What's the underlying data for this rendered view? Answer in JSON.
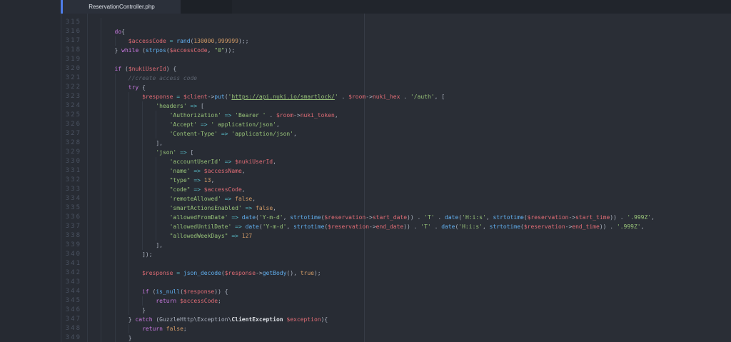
{
  "colors": {
    "bg": "#282c34",
    "sidebar_bg": "#262a32",
    "tabbar_bg": "#21252c",
    "tab_active_bg": "#2b303a",
    "accent": "#4e7de9",
    "text": "#abb2bf",
    "keyword": "#c678dd",
    "variable": "#e06c75",
    "function": "#61afef",
    "string": "#98c379",
    "number": "#d19a66",
    "operator": "#56b6c2",
    "comment": "#5b626e",
    "class": "#dcdfe4",
    "gutter": "#4a5261"
  },
  "tabbar": {
    "tabs": [
      {
        "label": "ReservationController.php",
        "active": true
      }
    ]
  },
  "editor": {
    "first_visible_line": 315,
    "last_visible_line": 349,
    "clipped_line_hint": "...",
    "lines": [
      {
        "n": 315,
        "indent": 2,
        "tokens": []
      },
      {
        "n": 316,
        "indent": 2,
        "tokens": [
          [
            "kw",
            "do"
          ],
          [
            "txt",
            "{"
          ]
        ]
      },
      {
        "n": 317,
        "indent": 3,
        "tokens": [
          [
            "var",
            "$accessCode"
          ],
          [
            "txt",
            " "
          ],
          [
            "op",
            "="
          ],
          [
            "txt",
            " "
          ],
          [
            "fn",
            "rand"
          ],
          [
            "txt",
            "("
          ],
          [
            "num",
            "130000"
          ],
          [
            "txt",
            ","
          ],
          [
            "num",
            "999999"
          ],
          [
            "txt",
            ");;"
          ]
        ]
      },
      {
        "n": 318,
        "indent": 2,
        "tokens": [
          [
            "txt",
            "} "
          ],
          [
            "kw",
            "while"
          ],
          [
            "txt",
            " ("
          ],
          [
            "fn",
            "strpos"
          ],
          [
            "txt",
            "("
          ],
          [
            "var",
            "$accessCode"
          ],
          [
            "txt",
            ", "
          ],
          [
            "str",
            "\"0\""
          ],
          [
            "txt",
            "));"
          ]
        ]
      },
      {
        "n": 319,
        "indent": 2,
        "tokens": []
      },
      {
        "n": 320,
        "indent": 2,
        "tokens": [
          [
            "kw",
            "if"
          ],
          [
            "txt",
            " ("
          ],
          [
            "var",
            "$nukiUserId"
          ],
          [
            "txt",
            ") {"
          ]
        ]
      },
      {
        "n": 321,
        "indent": 3,
        "tokens": [
          [
            "cmt",
            "//create access code"
          ]
        ]
      },
      {
        "n": 322,
        "indent": 3,
        "tokens": [
          [
            "kw",
            "try"
          ],
          [
            "txt",
            " {"
          ]
        ]
      },
      {
        "n": 323,
        "indent": 4,
        "tokens": [
          [
            "var",
            "$response"
          ],
          [
            "txt",
            " "
          ],
          [
            "op",
            "="
          ],
          [
            "txt",
            " "
          ],
          [
            "var",
            "$client"
          ],
          [
            "txt",
            "->"
          ],
          [
            "fn",
            "put"
          ],
          [
            "txt",
            "("
          ],
          [
            "str",
            "'"
          ],
          [
            "url",
            "https://api.nuki.io/smartlock/"
          ],
          [
            "str",
            "'"
          ],
          [
            "txt",
            " . "
          ],
          [
            "var",
            "$room"
          ],
          [
            "txt",
            "->"
          ],
          [
            "var",
            "nuki_hex"
          ],
          [
            "txt",
            " . "
          ],
          [
            "str",
            "'/auth'"
          ],
          [
            "txt",
            ", ["
          ]
        ]
      },
      {
        "n": 324,
        "indent": 5,
        "tokens": [
          [
            "str",
            "'headers'"
          ],
          [
            "txt",
            " "
          ],
          [
            "op",
            "=>"
          ],
          [
            "txt",
            " ["
          ]
        ]
      },
      {
        "n": 325,
        "indent": 6,
        "tokens": [
          [
            "str",
            "'Authorization'"
          ],
          [
            "txt",
            " "
          ],
          [
            "op",
            "=>"
          ],
          [
            "txt",
            " "
          ],
          [
            "str",
            "'Bearer '"
          ],
          [
            "txt",
            " . "
          ],
          [
            "var",
            "$room"
          ],
          [
            "txt",
            "->"
          ],
          [
            "var",
            "nuki_token"
          ],
          [
            "txt",
            ","
          ]
        ]
      },
      {
        "n": 326,
        "indent": 6,
        "tokens": [
          [
            "str",
            "'Accept'"
          ],
          [
            "txt",
            " "
          ],
          [
            "op",
            "=>"
          ],
          [
            "txt",
            " "
          ],
          [
            "str",
            "' application/json'"
          ],
          [
            "txt",
            ","
          ]
        ]
      },
      {
        "n": 327,
        "indent": 6,
        "tokens": [
          [
            "str",
            "'Content-Type'"
          ],
          [
            "txt",
            " "
          ],
          [
            "op",
            "=>"
          ],
          [
            "txt",
            " "
          ],
          [
            "str",
            "'application/json'"
          ],
          [
            "txt",
            ","
          ]
        ]
      },
      {
        "n": 328,
        "indent": 5,
        "tokens": [
          [
            "txt",
            "],"
          ]
        ]
      },
      {
        "n": 329,
        "indent": 5,
        "tokens": [
          [
            "str",
            "'json'"
          ],
          [
            "txt",
            " "
          ],
          [
            "op",
            "=>"
          ],
          [
            "txt",
            " ["
          ]
        ]
      },
      {
        "n": 330,
        "indent": 6,
        "tokens": [
          [
            "str",
            "'accountUserId'"
          ],
          [
            "txt",
            " "
          ],
          [
            "op",
            "=>"
          ],
          [
            "txt",
            " "
          ],
          [
            "var",
            "$nukiUserId"
          ],
          [
            "txt",
            ","
          ]
        ]
      },
      {
        "n": 331,
        "indent": 6,
        "tokens": [
          [
            "str",
            "'name'"
          ],
          [
            "txt",
            " "
          ],
          [
            "op",
            "=>"
          ],
          [
            "txt",
            " "
          ],
          [
            "var",
            "$accessName"
          ],
          [
            "txt",
            ","
          ]
        ]
      },
      {
        "n": 332,
        "indent": 6,
        "tokens": [
          [
            "str",
            "\"type\""
          ],
          [
            "txt",
            " "
          ],
          [
            "op",
            "=>"
          ],
          [
            "txt",
            " "
          ],
          [
            "num",
            "13"
          ],
          [
            "txt",
            ","
          ]
        ]
      },
      {
        "n": 333,
        "indent": 6,
        "tokens": [
          [
            "str",
            "\"code\""
          ],
          [
            "txt",
            " "
          ],
          [
            "op",
            "=>"
          ],
          [
            "txt",
            " "
          ],
          [
            "var",
            "$accessCode"
          ],
          [
            "txt",
            ","
          ]
        ]
      },
      {
        "n": 334,
        "indent": 6,
        "tokens": [
          [
            "str",
            "'remoteAllowed'"
          ],
          [
            "txt",
            " "
          ],
          [
            "op",
            "=>"
          ],
          [
            "txt",
            " "
          ],
          [
            "num",
            "false"
          ],
          [
            "txt",
            ","
          ]
        ]
      },
      {
        "n": 335,
        "indent": 6,
        "tokens": [
          [
            "str",
            "'smartActionsEnabled'"
          ],
          [
            "txt",
            " "
          ],
          [
            "op",
            "=>"
          ],
          [
            "txt",
            " "
          ],
          [
            "num",
            "false"
          ],
          [
            "txt",
            ","
          ]
        ]
      },
      {
        "n": 336,
        "indent": 6,
        "tokens": [
          [
            "str",
            "'allowedFromDate'"
          ],
          [
            "txt",
            " "
          ],
          [
            "op",
            "=>"
          ],
          [
            "txt",
            " "
          ],
          [
            "fn",
            "date"
          ],
          [
            "txt",
            "("
          ],
          [
            "str",
            "'Y-m-d'"
          ],
          [
            "txt",
            ", "
          ],
          [
            "fn",
            "strtotime"
          ],
          [
            "txt",
            "("
          ],
          [
            "var",
            "$reservation"
          ],
          [
            "txt",
            "->"
          ],
          [
            "var",
            "start_date"
          ],
          [
            "txt",
            ")) . "
          ],
          [
            "str",
            "'T'"
          ],
          [
            "txt",
            " . "
          ],
          [
            "fn",
            "date"
          ],
          [
            "txt",
            "("
          ],
          [
            "str",
            "'H:i:s'"
          ],
          [
            "txt",
            ", "
          ],
          [
            "fn",
            "strtotime"
          ],
          [
            "txt",
            "("
          ],
          [
            "var",
            "$reservation"
          ],
          [
            "txt",
            "->"
          ],
          [
            "var",
            "start_time"
          ],
          [
            "txt",
            ")) . "
          ],
          [
            "str",
            "'.999Z'"
          ],
          [
            "txt",
            ","
          ]
        ]
      },
      {
        "n": 337,
        "indent": 6,
        "tokens": [
          [
            "str",
            "'allowedUntilDate'"
          ],
          [
            "txt",
            " "
          ],
          [
            "op",
            "=>"
          ],
          [
            "txt",
            " "
          ],
          [
            "fn",
            "date"
          ],
          [
            "txt",
            "("
          ],
          [
            "str",
            "'Y-m-d'"
          ],
          [
            "txt",
            ", "
          ],
          [
            "fn",
            "strtotime"
          ],
          [
            "txt",
            "("
          ],
          [
            "var",
            "$reservation"
          ],
          [
            "txt",
            "->"
          ],
          [
            "var",
            "end_date"
          ],
          [
            "txt",
            ")) . "
          ],
          [
            "str",
            "'T'"
          ],
          [
            "txt",
            " . "
          ],
          [
            "fn",
            "date"
          ],
          [
            "txt",
            "("
          ],
          [
            "str",
            "'H:i:s'"
          ],
          [
            "txt",
            ", "
          ],
          [
            "fn",
            "strtotime"
          ],
          [
            "txt",
            "("
          ],
          [
            "var",
            "$reservation"
          ],
          [
            "txt",
            "->"
          ],
          [
            "var",
            "end_time"
          ],
          [
            "txt",
            ")) . "
          ],
          [
            "str",
            "'.999Z'"
          ],
          [
            "txt",
            ","
          ]
        ]
      },
      {
        "n": 338,
        "indent": 6,
        "tokens": [
          [
            "str",
            "\"allowedWeekDays\""
          ],
          [
            "txt",
            " "
          ],
          [
            "op",
            "=>"
          ],
          [
            "txt",
            " "
          ],
          [
            "num",
            "127"
          ]
        ]
      },
      {
        "n": 339,
        "indent": 5,
        "tokens": [
          [
            "txt",
            "],"
          ]
        ]
      },
      {
        "n": 340,
        "indent": 4,
        "tokens": [
          [
            "txt",
            "]);"
          ]
        ]
      },
      {
        "n": 341,
        "indent": 4,
        "tokens": []
      },
      {
        "n": 342,
        "indent": 4,
        "tokens": [
          [
            "var",
            "$response"
          ],
          [
            "txt",
            " "
          ],
          [
            "op",
            "="
          ],
          [
            "txt",
            " "
          ],
          [
            "fn",
            "json_decode"
          ],
          [
            "txt",
            "("
          ],
          [
            "var",
            "$response"
          ],
          [
            "txt",
            "->"
          ],
          [
            "fn",
            "getBody"
          ],
          [
            "txt",
            "(), "
          ],
          [
            "num",
            "true"
          ],
          [
            "txt",
            ");"
          ]
        ]
      },
      {
        "n": 343,
        "indent": 4,
        "tokens": []
      },
      {
        "n": 344,
        "indent": 4,
        "tokens": [
          [
            "kw",
            "if"
          ],
          [
            "txt",
            " ("
          ],
          [
            "fn",
            "is_null"
          ],
          [
            "txt",
            "("
          ],
          [
            "var",
            "$response"
          ],
          [
            "txt",
            ")) {"
          ]
        ]
      },
      {
        "n": 345,
        "indent": 5,
        "tokens": [
          [
            "kw",
            "return"
          ],
          [
            "txt",
            " "
          ],
          [
            "var",
            "$accessCode"
          ],
          [
            "txt",
            ";"
          ]
        ]
      },
      {
        "n": 346,
        "indent": 4,
        "tokens": [
          [
            "txt",
            "}"
          ]
        ]
      },
      {
        "n": 347,
        "indent": 3,
        "tokens": [
          [
            "txt",
            "} "
          ],
          [
            "kw",
            "catch"
          ],
          [
            "txt",
            " ("
          ],
          [
            "txt",
            "GuzzleHttp\\Exception\\"
          ],
          [
            "cls",
            "ClientException"
          ],
          [
            "txt",
            " "
          ],
          [
            "var",
            "$exception"
          ],
          [
            "txt",
            "){"
          ]
        ]
      },
      {
        "n": 348,
        "indent": 4,
        "tokens": [
          [
            "kw",
            "return"
          ],
          [
            "txt",
            " "
          ],
          [
            "num",
            "false"
          ],
          [
            "txt",
            ";"
          ]
        ]
      },
      {
        "n": 349,
        "indent": 3,
        "tokens": [
          [
            "txt",
            "}"
          ]
        ]
      }
    ]
  }
}
